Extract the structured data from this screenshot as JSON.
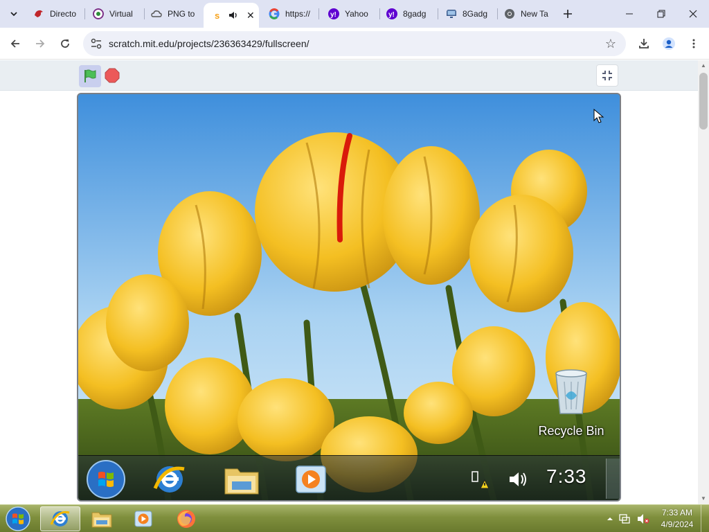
{
  "browser": {
    "tabs": [
      {
        "title": "Directo",
        "favicon": "red-bird-icon",
        "color": "#c0262b"
      },
      {
        "title": "Virtual",
        "favicon": "wikipedia-icon",
        "color": "#7a2e86"
      },
      {
        "title": "PNG to",
        "favicon": "cloud-icon",
        "color": "#555555"
      },
      {
        "title": "",
        "favicon": "scratch-icon",
        "color": "#f7a21b",
        "active": true
      },
      {
        "title": "https://",
        "favicon": "google-icon",
        "color": "#4285f4"
      },
      {
        "title": "Yahoo",
        "favicon": "yahoo-icon",
        "color": "#5f01d1"
      },
      {
        "title": "8gadg",
        "favicon": "yahoo-icon",
        "color": "#5f01d1"
      },
      {
        "title": "8Gadg",
        "favicon": "monitor-icon",
        "color": "#3b5b8c"
      },
      {
        "title": "New Ta",
        "favicon": "chrome-icon",
        "color": "#5f6368"
      }
    ],
    "url": "scratch.mit.edu/projects/236363429/fullscreen/"
  },
  "stage": {
    "desktop_icon_label": "Recycle Bin",
    "clock": "7:33"
  },
  "taskbar": {
    "time": "7:33 AM",
    "date": "4/9/2024"
  },
  "colors": {
    "tabstrip": "#dfe3f3",
    "omnibox": "#eef0f8",
    "scratch_bar": "#e9eef2",
    "flag_green": "#4cbf56",
    "stop_red": "#ec5959",
    "taskbar": "#7f8f3d"
  }
}
